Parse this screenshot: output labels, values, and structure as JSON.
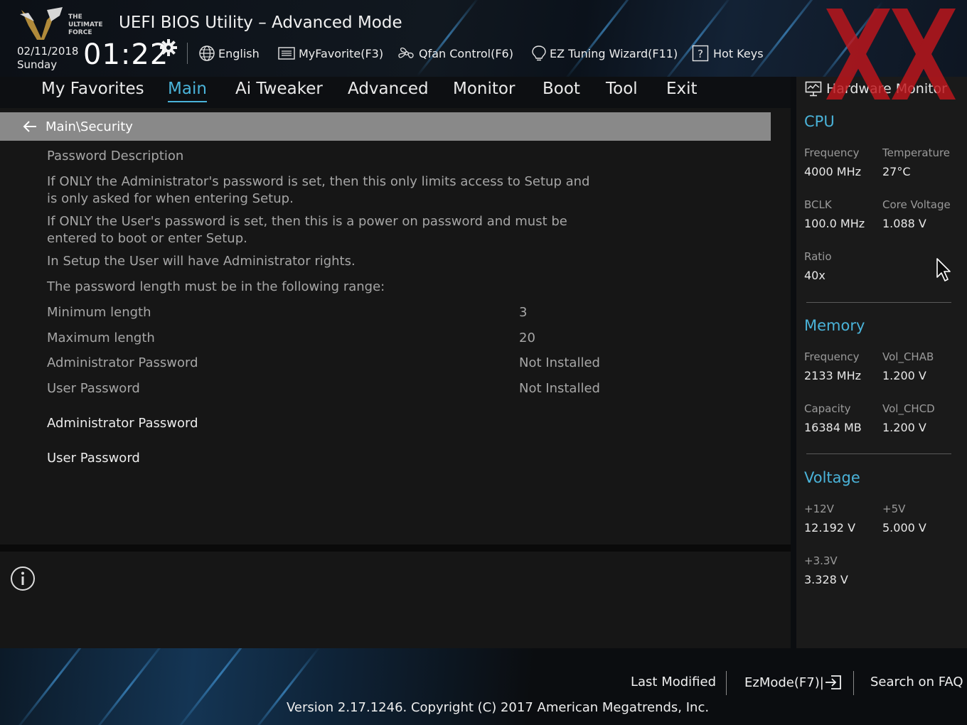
{
  "header": {
    "logo_text": "THE ULTIMATE FORCE",
    "title": "UEFI BIOS Utility – Advanced Mode",
    "date": "02/11/2018",
    "day": "Sunday",
    "time": "01:22",
    "toolbar": {
      "language": "English",
      "myfavorite": "MyFavorite(F3)",
      "qfan": "Qfan Control(F6)",
      "ez_tuning": "EZ Tuning Wizard(F11)",
      "hotkeys": "Hot Keys"
    }
  },
  "tabs": [
    {
      "label": "My Favorites",
      "active": false
    },
    {
      "label": "Main",
      "active": true
    },
    {
      "label": "Ai Tweaker",
      "active": false
    },
    {
      "label": "Advanced",
      "active": false
    },
    {
      "label": "Monitor",
      "active": false
    },
    {
      "label": "Boot",
      "active": false
    },
    {
      "label": "Tool",
      "active": false
    },
    {
      "label": "Exit",
      "active": false
    }
  ],
  "main": {
    "breadcrumb": "Main\\Security",
    "description": {
      "heading": "Password Description",
      "p1_line1": "If ONLY the Administrator's password is set, then this only limits access to Setup and",
      "p1_line2": "is only asked for when entering Setup.",
      "p2_line1": "If ONLY the User's password is set, then this is a power on password and must be",
      "p2_line2": "entered to boot or enter Setup.",
      "p3": "In Setup the User will have Administrator rights.",
      "p4": "The password length must be in the following range:"
    },
    "info_rows": [
      {
        "label": "Minimum length",
        "value": "3"
      },
      {
        "label": "Maximum length",
        "value": "20"
      },
      {
        "label": "Administrator Password",
        "value": "Not Installed"
      },
      {
        "label": "User Password",
        "value": "Not Installed"
      }
    ],
    "actions": {
      "admin_password": "Administrator Password",
      "user_password": "User Password"
    }
  },
  "hardware_monitor": {
    "title": "Hardware Monitor",
    "cpu": {
      "heading": "CPU",
      "frequency_label": "Frequency",
      "frequency": "4000 MHz",
      "temperature_label": "Temperature",
      "temperature": "27°C",
      "bclk_label": "BCLK",
      "bclk": "100.0 MHz",
      "core_voltage_label": "Core Voltage",
      "core_voltage": "1.088 V",
      "ratio_label": "Ratio",
      "ratio": "40x"
    },
    "memory": {
      "heading": "Memory",
      "frequency_label": "Frequency",
      "frequency": "2133 MHz",
      "vol_chab_label": "Vol_CHAB",
      "vol_chab": "1.200 V",
      "capacity_label": "Capacity",
      "capacity": "16384 MB",
      "vol_chcd_label": "Vol_CHCD",
      "vol_chcd": "1.200 V"
    },
    "voltage": {
      "heading": "Voltage",
      "v12_label": "+12V",
      "v12": "12.192 V",
      "v5_label": "+5V",
      "v5": "5.000 V",
      "v33_label": "+3.3V",
      "v33": "3.328 V"
    }
  },
  "footer": {
    "last_modified": "Last Modified",
    "ezmode": "EzMode(F7)|",
    "search_faq": "Search on FAQ",
    "copyright": "Version 2.17.1246. Copyright (C) 2017 American Megatrends, Inc."
  },
  "colors": {
    "accent": "#4ab3d9",
    "watermark": "#c0161c",
    "breadcrumb_bg": "#898989",
    "panel_bg": "#161616"
  }
}
